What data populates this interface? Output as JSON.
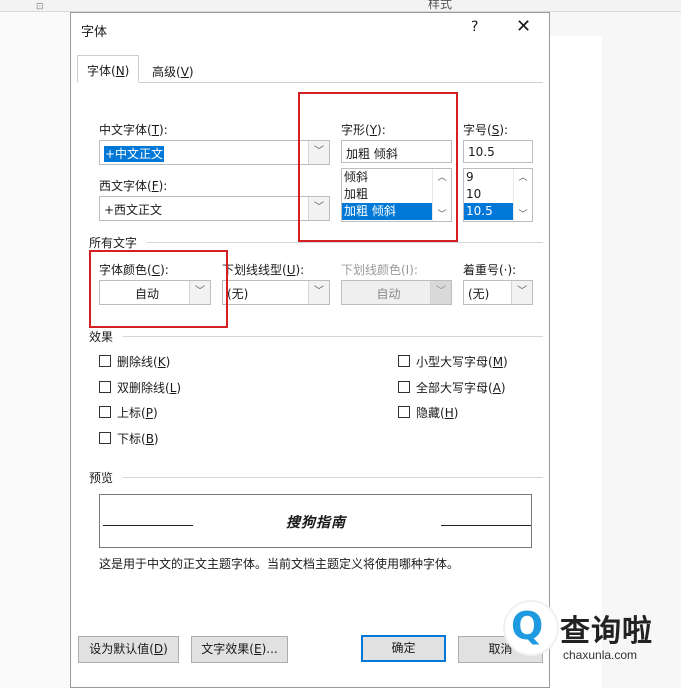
{
  "background": {
    "styles_label": "样式",
    "corner_glyph": "⊡"
  },
  "dialog": {
    "title": "字体",
    "help": "?",
    "close": "✕"
  },
  "tabs": [
    {
      "text": "字体(",
      "key": "N",
      "end": ")"
    },
    {
      "text": "高级(",
      "key": "V",
      "end": ")"
    }
  ],
  "fonts": {
    "cn_label": {
      "text": "中文字体(",
      "key": "T",
      "end": "):"
    },
    "cn_value": "+中文正文",
    "west_label": {
      "text": "西文字体(",
      "key": "F",
      "end": "):"
    },
    "west_value": "+西文正文"
  },
  "style": {
    "label": {
      "text": "字形(",
      "key": "Y",
      "end": "):"
    },
    "value": "加粗 倾斜",
    "options": [
      "倾斜",
      "加粗",
      "加粗 倾斜"
    ],
    "selected_index": 2
  },
  "size": {
    "label": {
      "text": "字号(",
      "key": "S",
      "end": "):"
    },
    "value": "10.5",
    "options": [
      "9",
      "10",
      "10.5"
    ],
    "selected_index": 2
  },
  "all_text": {
    "section": "所有文字",
    "color_label": {
      "text": "字体颜色(",
      "key": "C",
      "end": "):"
    },
    "color_value": "自动",
    "underline_label": {
      "text": "下划线线型(",
      "key": "U",
      "end": "):"
    },
    "underline_value": "(无)",
    "underline_color_label": "下划线颜色(I):",
    "underline_color_value": "自动",
    "emphasis_label": "着重号(·):",
    "emphasis_value": "(无)"
  },
  "effects": {
    "section": "效果",
    "left": [
      {
        "text": "删除线(",
        "key": "K",
        "end": ")"
      },
      {
        "text": "双删除线(",
        "key": "L",
        "end": ")"
      },
      {
        "text": "上标(",
        "key": "P",
        "end": ")"
      },
      {
        "text": "下标(",
        "key": "B",
        "end": ")"
      }
    ],
    "right": [
      {
        "text": "小型大写字母(",
        "key": "M",
        "end": ")"
      },
      {
        "text": "全部大写字母(",
        "key": "A",
        "end": ")"
      },
      {
        "text": "隐藏(",
        "key": "H",
        "end": ")"
      }
    ]
  },
  "preview": {
    "section": "预览",
    "sample": "搜狗指南",
    "note": "这是用于中文的正文主题字体。当前文档主题定义将使用哪种字体。"
  },
  "buttons": {
    "default": {
      "text": "设为默认值(",
      "key": "D",
      "end": ")"
    },
    "effects": {
      "text": "文字效果(",
      "key": "E",
      "end": ")..."
    },
    "ok": "确定",
    "cancel": "取消"
  },
  "watermark": {
    "site_name": "查询啦",
    "url": "chaxunla.com"
  },
  "highlight_color": "#d42020",
  "accent_color": "#0078d7"
}
